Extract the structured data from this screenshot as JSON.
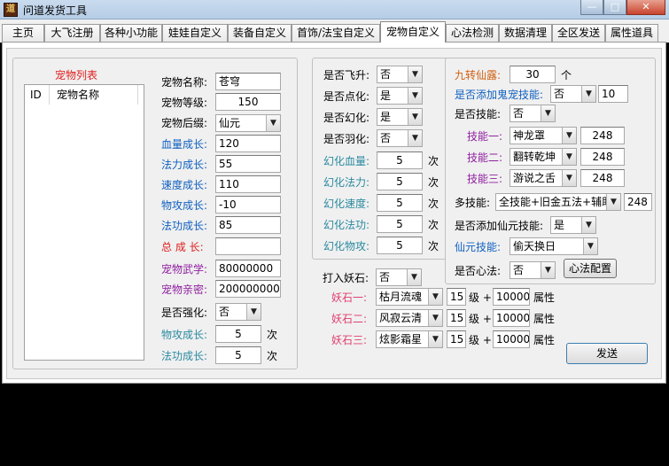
{
  "window": {
    "title": "问道发货工具",
    "app_icon": "道"
  },
  "tabs": [
    "主页",
    "大飞注册",
    "各种小功能",
    "娃娃自定义",
    "装备自定义",
    "首饰/法宝自定义",
    "宠物自定义",
    "心法检测",
    "数据清理",
    "全区发送",
    "属性道具"
  ],
  "active_tab": "宠物自定义",
  "pet_list": {
    "title": "宠物列表",
    "columns": [
      "ID",
      "宠物名称"
    ]
  },
  "pet_info": {
    "name_label": "宠物名称:",
    "name_value": "苍穹",
    "level_label": "宠物等级:",
    "level_value": "150",
    "suffix_label": "宠物后缀:",
    "suffix_value": "仙元",
    "hp_growth_label": "血量成长:",
    "hp_growth_value": "120",
    "mp_growth_label": "法力成长:",
    "mp_growth_value": "55",
    "speed_growth_label": "速度成长:",
    "speed_growth_value": "110",
    "patk_growth_label": "物攻成长:",
    "patk_growth_value": "-10",
    "matk_growth_label": "法功成长:",
    "matk_growth_value": "85",
    "total_growth_label": "总 成 长:",
    "total_growth_value": "",
    "martial_label": "宠物武学:",
    "martial_value": "80000000",
    "intimacy_label": "宠物亲密:",
    "intimacy_value": "200000000",
    "strengthen_label": "是否强化:",
    "strengthen_value": "否",
    "patk_strengthen_label": "物攻成长:",
    "patk_strengthen_value": "5",
    "patk_strengthen_unit": "次",
    "matk_strengthen_label": "法功成长:",
    "matk_strengthen_value": "5",
    "matk_strengthen_unit": "次"
  },
  "transform": {
    "fly_label": "是否飞升:",
    "fly_value": "否",
    "dot_label": "是否点化:",
    "dot_value": "是",
    "huan_label": "是否幻化:",
    "huan_value": "是",
    "feather_label": "是否羽化:",
    "feather_value": "否",
    "hp_label": "幻化血量:",
    "hp_value": "5",
    "hp_unit": "次",
    "mp_label": "幻化法力:",
    "mp_value": "5",
    "mp_unit": "次",
    "speed_label": "幻化速度:",
    "speed_value": "5",
    "speed_unit": "次",
    "matk_label": "幻化法功:",
    "matk_value": "5",
    "matk_unit": "次",
    "patk_label": "幻化物攻:",
    "patk_value": "5",
    "patk_unit": "次"
  },
  "demon_stone": {
    "enter_label": "打入妖石:",
    "enter_value": "否",
    "rows": [
      {
        "label": "妖石一:",
        "stone": "枯月流魂",
        "level": "15",
        "level_unit": "级 +",
        "attr": "10000",
        "attr_unit": "属性"
      },
      {
        "label": "妖石二:",
        "stone": "风寂云清",
        "level": "15",
        "level_unit": "级 +",
        "attr": "10000",
        "attr_unit": "属性"
      },
      {
        "label": "妖石三:",
        "stone": "炫影霜星",
        "level": "15",
        "level_unit": "级 +",
        "attr": "10000",
        "attr_unit": "属性"
      }
    ]
  },
  "skills": {
    "dew_label": "九转仙露:",
    "dew_value": "30",
    "dew_unit": "个",
    "ghost_label": "是否添加鬼宠技能:",
    "ghost_value": "否",
    "ghost_num": "10",
    "skill_label": "是否技能:",
    "skill_value": "否",
    "skill_rows": [
      {
        "label": "技能一:",
        "skill": "神龙罩",
        "value": "248"
      },
      {
        "label": "技能二:",
        "skill": "翻转乾坤",
        "value": "248"
      },
      {
        "label": "技能三:",
        "skill": "游说之舌",
        "value": "248"
      }
    ],
    "multi_label": "多技能:",
    "multi_value": "全技能+旧金五法+辅助",
    "multi_num": "248",
    "xian_add_label": "是否添加仙元技能:",
    "xian_add_value": "是",
    "xian_skill_label": "仙元技能:",
    "xian_skill_value": "偷天换日",
    "xinfa_label": "是否心法:",
    "xinfa_value": "否",
    "xinfa_button": "心法配置"
  },
  "send_button": "发送",
  "colors": {
    "label_blue": "#1060c0",
    "label_teal": "#2a8aa0",
    "label_red": "#e02020",
    "label_purple": "#9020a0",
    "label_pink": "#e04070",
    "label_orange": "#d06010"
  }
}
